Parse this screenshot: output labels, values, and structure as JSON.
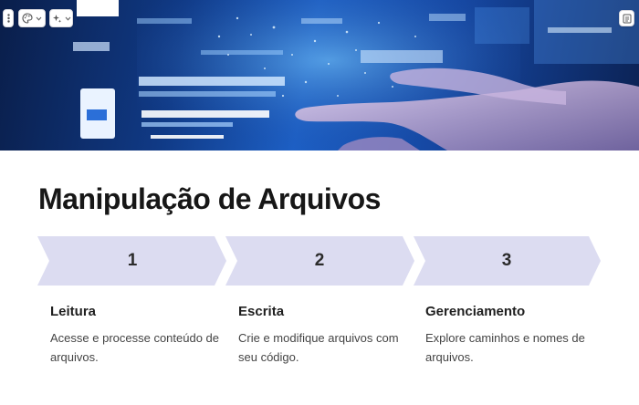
{
  "hero": {
    "image_label": "Mão tocando uma tela de dados digital"
  },
  "toolbar": {
    "drag_icon": "vertical-dots-icon",
    "theme_icon": "palette-icon",
    "ai_icon": "sparkle-icon",
    "notes_icon": "notes-icon"
  },
  "title": "Manipulação de Arquivos",
  "steps": [
    {
      "number": "1",
      "heading": "Leitura",
      "description": "Acesse e processe conteúdo de arquivos."
    },
    {
      "number": "2",
      "heading": "Escrita",
      "description": "Crie e modifique arquivos com seu código."
    },
    {
      "number": "3",
      "heading": "Gerenciamento",
      "description": "Explore caminhos e nomes de arquivos."
    }
  ],
  "colors": {
    "chevron_fill": "#dcdcf1",
    "heading": "#171717"
  }
}
